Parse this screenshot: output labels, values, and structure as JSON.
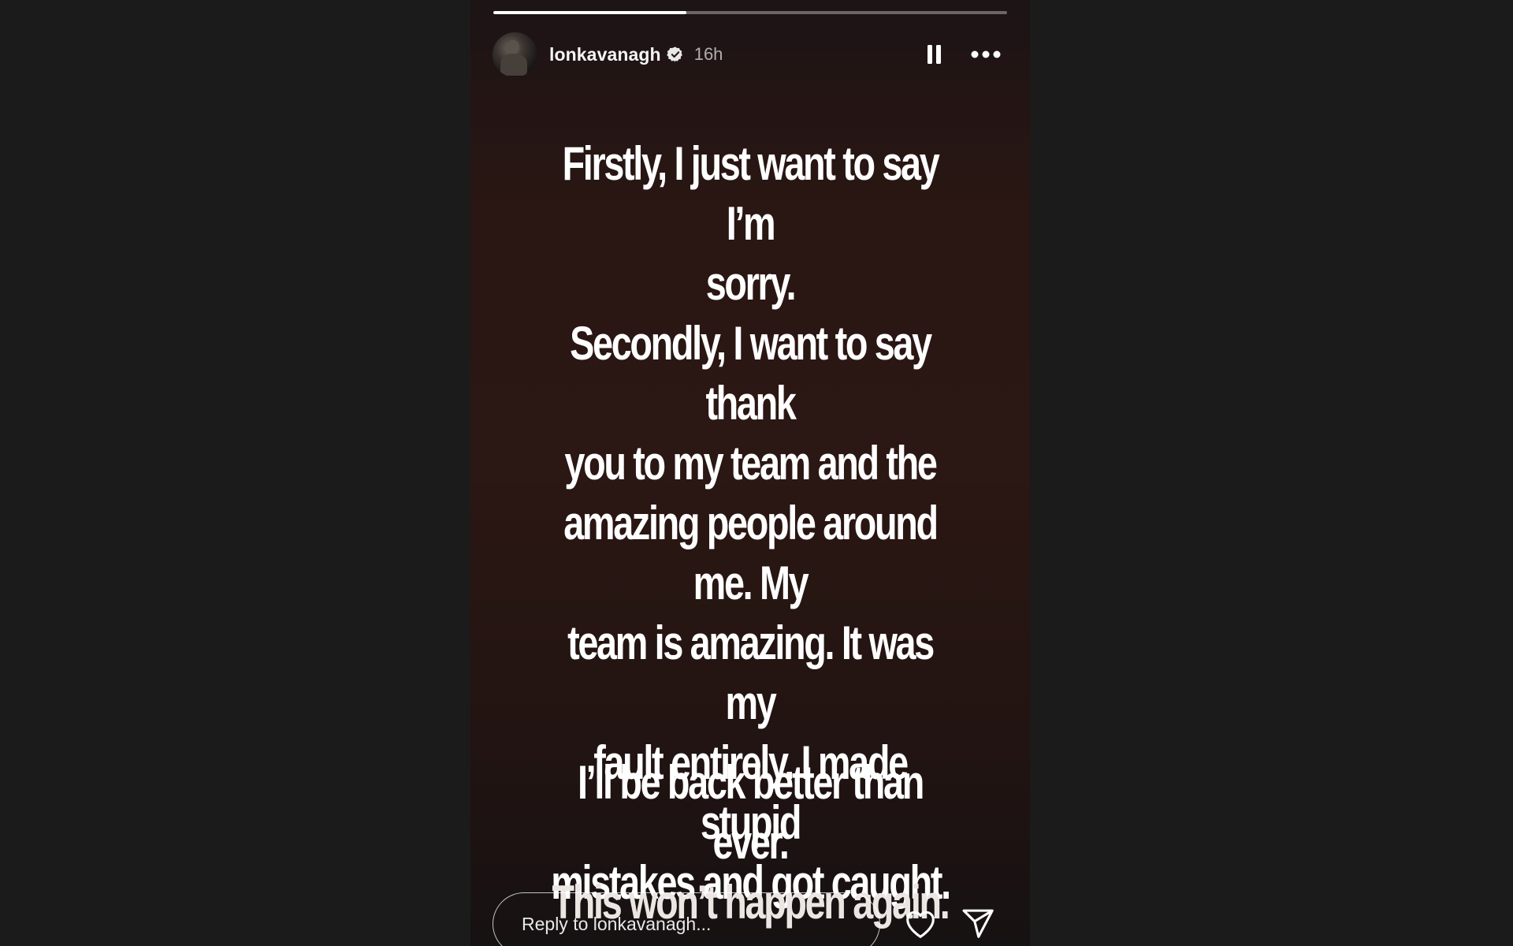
{
  "story": {
    "progress": 0.375,
    "user": {
      "username": "lonkavanagh",
      "verified": true,
      "time_ago": "16h"
    },
    "icons": {
      "avatar": "profile-avatar",
      "verified": "verified-badge-icon",
      "pause": "pause-icon",
      "more": "more-options-icon",
      "like": "heart-icon",
      "share": "send-icon"
    },
    "text": {
      "paragraph1": [
        "Firstly, I just want to say I’m",
        "sorry."
      ],
      "paragraph2": [
        "Secondly, I want to say thank",
        "you to my team and the",
        "amazing people around me. My",
        "team is amazing. It was my",
        "fault entirely. I made stupid",
        "mistakes and got caught."
      ],
      "paragraph3": [
        "I’ll be back better than ever.",
        "This won’t happen again."
      ]
    },
    "reply": {
      "placeholder": "Reply to lonkavanagh..."
    }
  }
}
